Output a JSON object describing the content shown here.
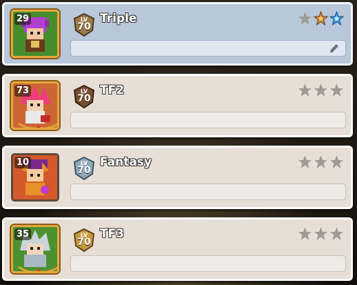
{
  "heroes": [
    {
      "name": "Triple",
      "level": "29",
      "badge_label": "LV",
      "badge_level": "70",
      "selected": true,
      "portrait": "purple-hair-hero",
      "badge_color": "#9a7a4a",
      "stars": [
        "empty",
        "bronze",
        "blue"
      ]
    },
    {
      "name": "TF2",
      "level": "73",
      "badge_label": "LV",
      "badge_level": "70",
      "selected": false,
      "portrait": "pink-spiky-hero",
      "badge_color": "#7a5032",
      "stars": [
        "empty",
        "empty",
        "empty"
      ]
    },
    {
      "name": "Fantasy",
      "level": "10",
      "badge_label": "LV",
      "badge_level": "70",
      "selected": false,
      "portrait": "orange-fox-hero",
      "badge_color": "#8fa8ba",
      "stars": [
        "empty",
        "empty",
        "empty"
      ]
    },
    {
      "name": "TF3",
      "level": "35",
      "badge_label": "LV",
      "badge_level": "70",
      "selected": false,
      "portrait": "silver-hair-hero",
      "badge_color": "#c79a3e",
      "stars": [
        "empty",
        "empty",
        "empty"
      ]
    }
  ]
}
